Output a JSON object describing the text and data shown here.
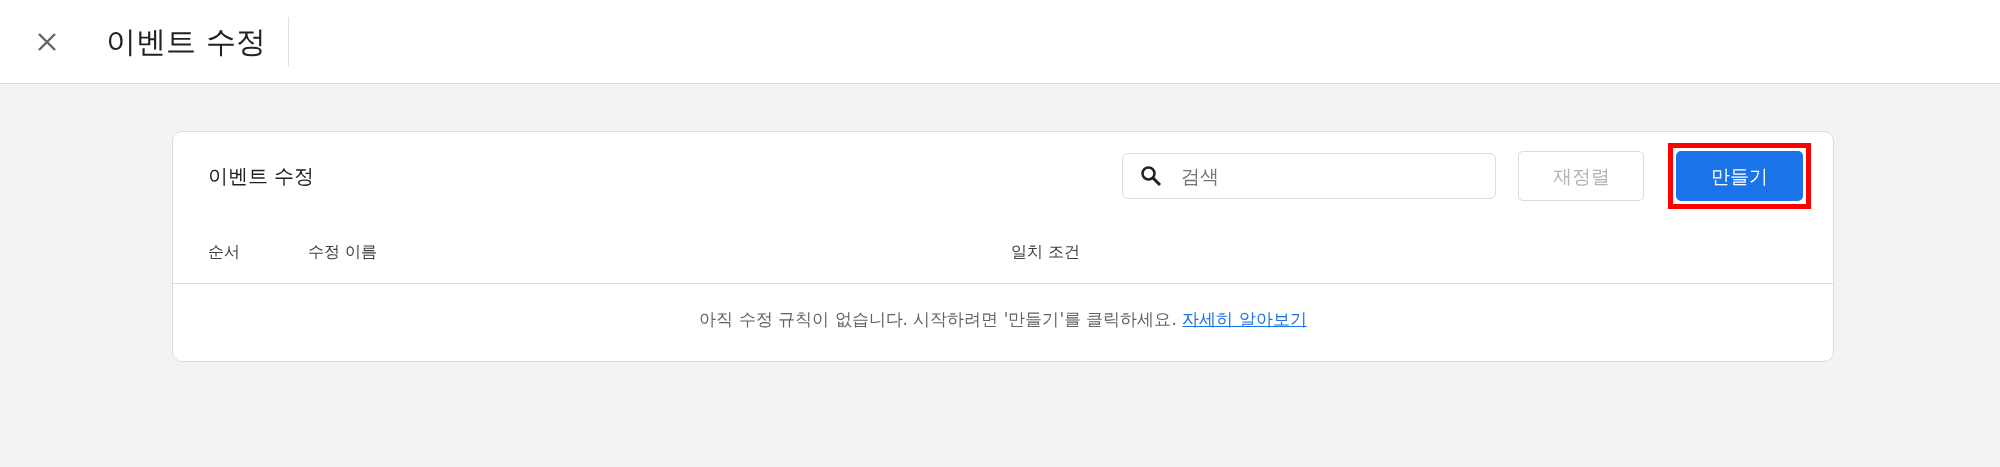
{
  "header": {
    "title": "이벤트 수정"
  },
  "card": {
    "title": "이벤트 수정",
    "search": {
      "placeholder": "검색"
    },
    "buttons": [
      {
        "kind": "reorder",
        "label": "재정렬",
        "disabled": true,
        "highlighted": false
      },
      {
        "kind": "create",
        "label": "만들기",
        "disabled": false,
        "highlighted": true
      }
    ],
    "table": {
      "columns": [
        "순서",
        "수정 이름",
        "일치 조건"
      ],
      "empty_message": "아직 수정 규칙이 없습니다. 시작하려면 '만들기'를 클릭하세요.",
      "link": "자세히 알아보기"
    }
  }
}
